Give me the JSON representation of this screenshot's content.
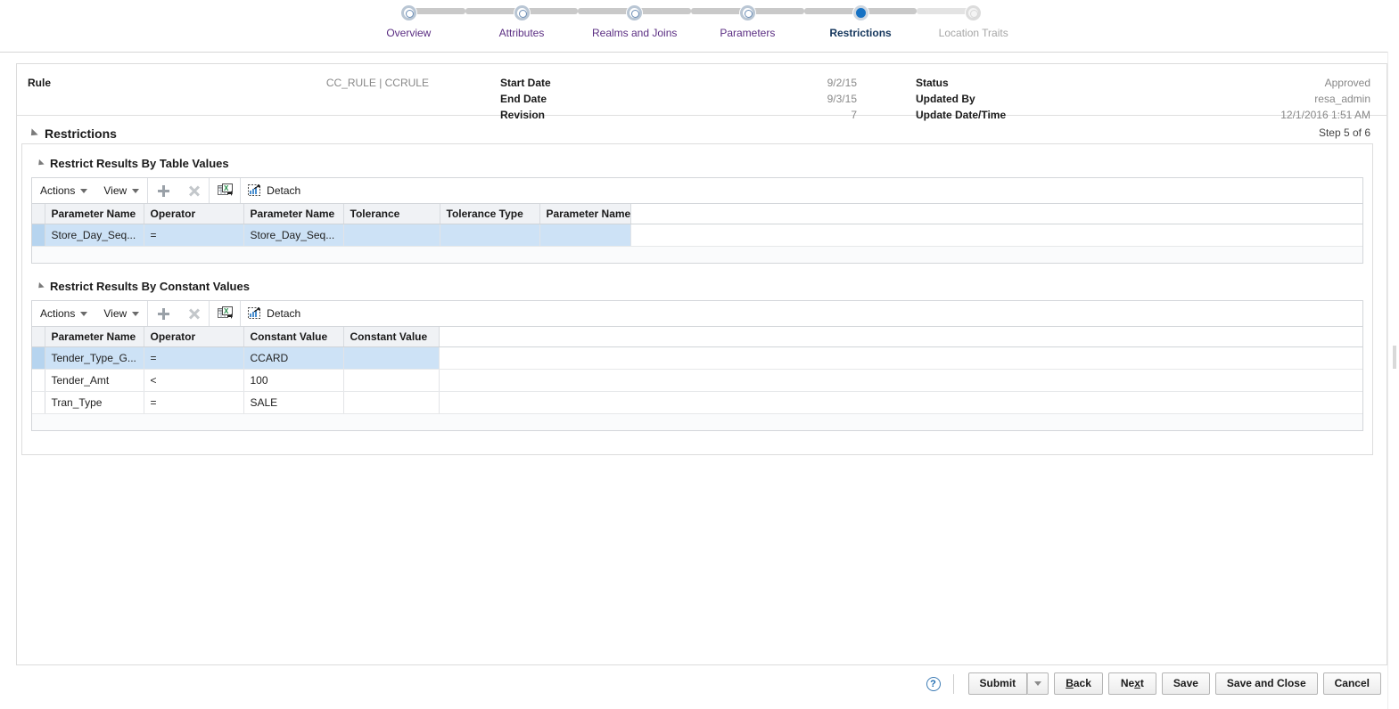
{
  "train": {
    "steps": [
      {
        "label": "Overview",
        "state": "visited"
      },
      {
        "label": "Attributes",
        "state": "visited"
      },
      {
        "label": "Realms and Joins",
        "state": "visited"
      },
      {
        "label": "Parameters",
        "state": "visited"
      },
      {
        "label": "Restrictions",
        "state": "active"
      },
      {
        "label": "Location Traits",
        "state": "future"
      }
    ]
  },
  "summary": {
    "rule_label": "Rule",
    "rule_value": "CC_RULE | CCRULE",
    "start_date_label": "Start Date",
    "start_date_value": "9/2/15",
    "end_date_label": "End Date",
    "end_date_value": "9/3/15",
    "revision_label": "Revision",
    "revision_value": "7",
    "status_label": "Status",
    "status_value": "Approved",
    "updated_by_label": "Updated By",
    "updated_by_value": "resa_admin",
    "update_datetime_label": "Update Date/Time",
    "update_datetime_value": "12/1/2016 1:51 AM"
  },
  "section": {
    "title": "Restrictions",
    "step_of": "Step 5 of 6"
  },
  "toolbar": {
    "actions_label": "Actions",
    "view_label": "View",
    "add_icon": "plus-icon",
    "delete_icon": "delete-x-icon",
    "export_icon": "export-to-excel-icon",
    "detach_icon": "detach-icon",
    "detach_label": "Detach"
  },
  "table_values": {
    "title": "Restrict Results By Table Values",
    "columns": [
      "Parameter Name",
      "Operator",
      "Parameter Name",
      "Tolerance",
      "Tolerance Type",
      "Parameter Name"
    ],
    "rows": [
      {
        "selected": true,
        "cells": [
          "Store_Day_Seq...",
          "=",
          "Store_Day_Seq...",
          "",
          "",
          ""
        ]
      }
    ]
  },
  "constant_values": {
    "title": "Restrict Results By Constant Values",
    "columns": [
      "Parameter Name",
      "Operator",
      "Constant Value",
      "Constant Value"
    ],
    "rows": [
      {
        "selected": true,
        "cells": [
          "Tender_Type_G...",
          "=",
          "CCARD",
          ""
        ]
      },
      {
        "selected": false,
        "cells": [
          "Tender_Amt",
          "<",
          "100",
          ""
        ]
      },
      {
        "selected": false,
        "cells": [
          "Tran_Type",
          "=",
          "SALE",
          ""
        ]
      }
    ]
  },
  "footer": {
    "help_icon": "help-question-icon",
    "submit_label": "Submit",
    "back_label": "Back",
    "next_label": "Next",
    "save_label": "Save",
    "save_close_label": "Save and Close",
    "cancel_label": "Cancel"
  },
  "colors": {
    "active_step": "#1672c4",
    "link_text": "#5a2d82",
    "selected_row": "#cde2f6",
    "header_bg": "#f0f2f5"
  }
}
